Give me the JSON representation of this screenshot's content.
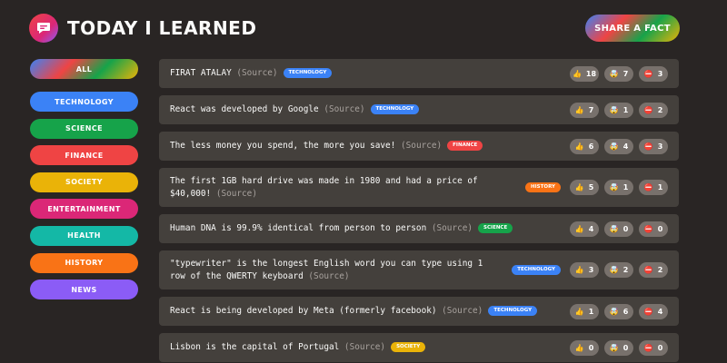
{
  "header": {
    "title": "Today I Learned",
    "share_label": "Share a fact"
  },
  "categories": [
    {
      "label": "All",
      "color": "gradient"
    },
    {
      "label": "Technology",
      "color": "#3b82f6"
    },
    {
      "label": "Science",
      "color": "#16a34a"
    },
    {
      "label": "Finance",
      "color": "#ef4444"
    },
    {
      "label": "Society",
      "color": "#eab308"
    },
    {
      "label": "Entertainment",
      "color": "#db2777"
    },
    {
      "label": "Health",
      "color": "#14b8a6"
    },
    {
      "label": "History",
      "color": "#f97316"
    },
    {
      "label": "News",
      "color": "#8b5cf6"
    }
  ],
  "source_label": "(Source)",
  "vote_icons": {
    "interesting": "thumbs-up-icon",
    "mindblowing": "mind-blown-icon",
    "false": "no-entry-icon"
  },
  "facts": [
    {
      "text": "FIRAT ATALAY",
      "tag": "technology",
      "tag_color": "#3b82f6",
      "tag_pos": "inline",
      "height": 32,
      "votes": [
        18,
        7,
        3
      ]
    },
    {
      "text": "React was developed by Google",
      "tag": "technology",
      "tag_color": "#3b82f6",
      "tag_pos": "inline",
      "height": 32,
      "votes": [
        7,
        1,
        2
      ]
    },
    {
      "text": "The less money you spend, the more you save!",
      "tag": "finance",
      "tag_color": "#ef4444",
      "tag_pos": "inline",
      "height": 32,
      "votes": [
        6,
        4,
        3
      ]
    },
    {
      "text": "The first 1GB hard drive was made in 1980 and had a price of $40,000!",
      "tag": "history",
      "tag_color": "#f97316",
      "tag_pos": "right",
      "height": 43,
      "votes": [
        5,
        1,
        1
      ]
    },
    {
      "text": "Human DNA is 99.9% identical from person to person",
      "tag": "science",
      "tag_color": "#16a34a",
      "tag_pos": "inline",
      "height": 32,
      "votes": [
        4,
        0,
        0
      ]
    },
    {
      "text": "\"typewriter\" is the longest English word you can type using 1 row of the QWERTY keyboard",
      "tag": "technology",
      "tag_color": "#3b82f6",
      "tag_pos": "right",
      "height": 43,
      "votes": [
        3,
        2,
        2
      ]
    },
    {
      "text": "React is being developed by Meta (formerly facebook)",
      "tag": "technology",
      "tag_color": "#3b82f6",
      "tag_pos": "inline",
      "height": 32,
      "votes": [
        1,
        6,
        4
      ]
    },
    {
      "text": "Lisbon is the capital of Portugal",
      "tag": "society",
      "tag_color": "#eab308",
      "tag_pos": "inline",
      "height": 32,
      "votes": [
        0,
        0,
        0
      ]
    }
  ]
}
